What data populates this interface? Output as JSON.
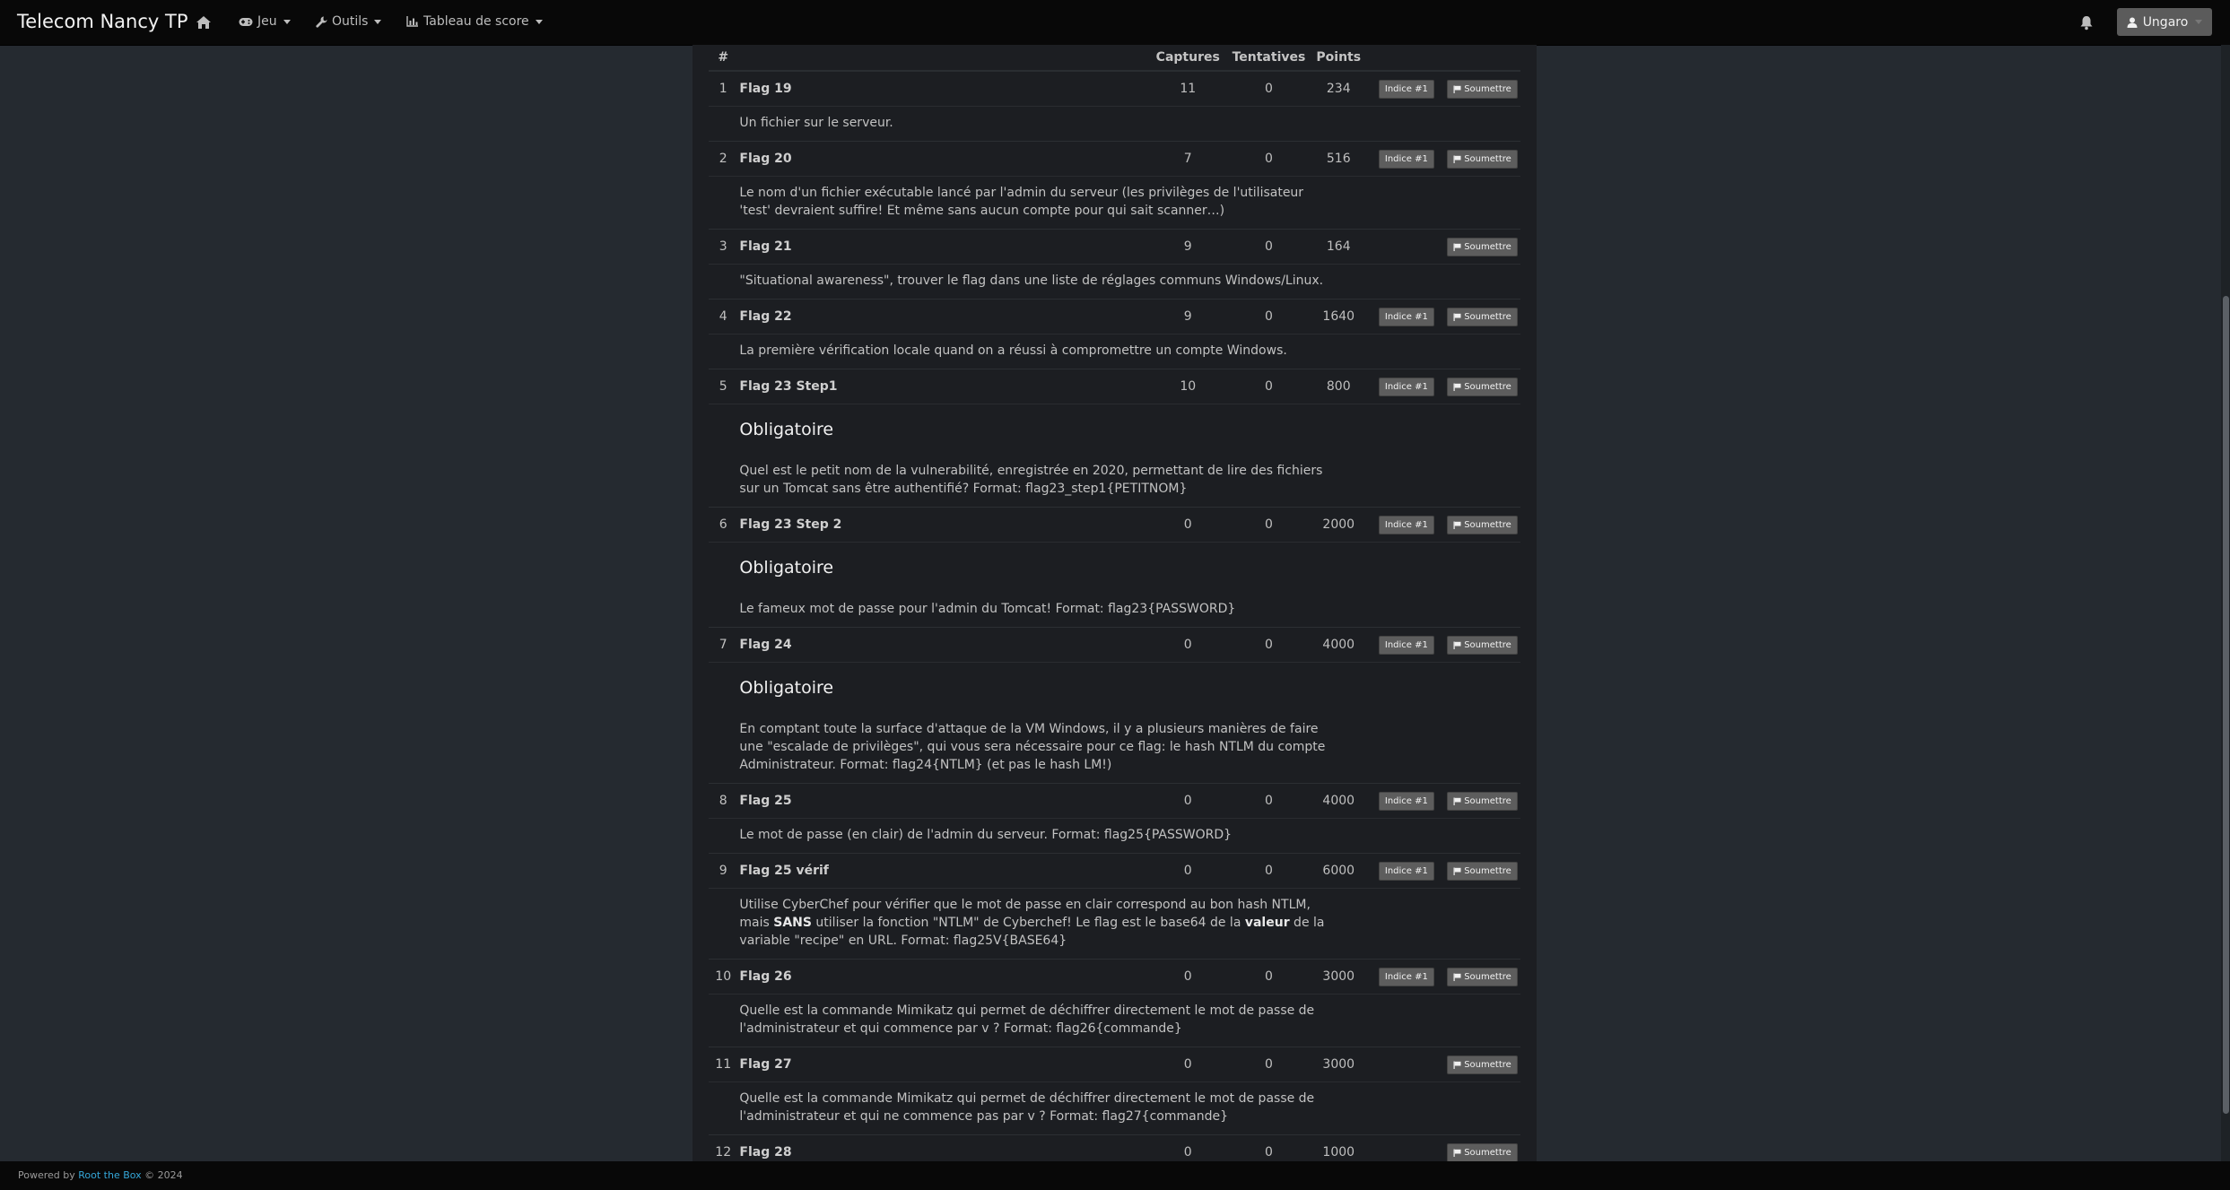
{
  "navbar": {
    "brand": "Telecom Nancy TP",
    "items": [
      {
        "label": "Jeu",
        "icon": "gamepad-icon"
      },
      {
        "label": "Outils",
        "icon": "wrench-icon"
      },
      {
        "label": "Tableau de score",
        "icon": "bar-chart-icon"
      }
    ],
    "user": "Ungaro"
  },
  "table": {
    "headers": {
      "num": "#",
      "name": "",
      "captures": "Captures",
      "attempts": "Tentatives",
      "points": "Points"
    },
    "hint_label": "Indice #1",
    "submit_label": "Soumettre",
    "mandatory_label": "Obligatoire",
    "rows": [
      {
        "num": "1",
        "name": "Flag 19",
        "captures": "11",
        "attempts": "0",
        "points": "234",
        "hint": true,
        "mandatory": false,
        "desc": "Un fichier sur le serveur."
      },
      {
        "num": "2",
        "name": "Flag 20",
        "captures": "7",
        "attempts": "0",
        "points": "516",
        "hint": true,
        "mandatory": false,
        "desc": "Le nom d'un fichier exécutable lancé par l'admin du serveur (les privilèges de l'utilisateur 'test' devraient suffire! Et même sans aucun compte pour qui sait scanner…)"
      },
      {
        "num": "3",
        "name": "Flag 21",
        "captures": "9",
        "attempts": "0",
        "points": "164",
        "hint": false,
        "mandatory": false,
        "desc": "\"Situational awareness\", trouver le flag dans une liste de réglages communs Windows/Linux."
      },
      {
        "num": "4",
        "name": "Flag 22",
        "captures": "9",
        "attempts": "0",
        "points": "1640",
        "hint": true,
        "mandatory": false,
        "desc": "La première vérification locale quand on a réussi à compromettre un compte Windows."
      },
      {
        "num": "5",
        "name": "Flag 23 Step1",
        "captures": "10",
        "attempts": "0",
        "points": "800",
        "hint": true,
        "mandatory": true,
        "desc": "Quel est le petit nom de la vulnerabilité, enregistrée en 2020, permettant de lire des fichiers sur un Tomcat sans être authentifié? Format: flag23_step1{PETITNOM}"
      },
      {
        "num": "6",
        "name": "Flag 23 Step 2",
        "captures": "0",
        "attempts": "0",
        "points": "2000",
        "hint": true,
        "mandatory": true,
        "desc": "Le fameux mot de passe pour l'admin du Tomcat! Format: flag23{PASSWORD}"
      },
      {
        "num": "7",
        "name": "Flag 24",
        "captures": "0",
        "attempts": "0",
        "points": "4000",
        "hint": true,
        "mandatory": true,
        "desc": "En comptant toute la surface d'attaque de la VM Windows, il y a plusieurs manières de faire une \"escalade de privilèges\", qui vous sera nécessaire pour ce flag: le hash NTLM du compte Administrateur. Format: flag24{NTLM} (et pas le hash LM!)"
      },
      {
        "num": "8",
        "name": "Flag 25",
        "captures": "0",
        "attempts": "0",
        "points": "4000",
        "hint": true,
        "mandatory": false,
        "desc": "Le mot de passe (en clair) de l'admin du serveur. Format: flag25{PASSWORD}"
      },
      {
        "num": "9",
        "name": "Flag 25 vérif",
        "captures": "0",
        "attempts": "0",
        "points": "6000",
        "hint": true,
        "mandatory": false,
        "desc_parts": [
          "Utilise CyberChef pour vérifier que le mot de passe en clair correspond au bon hash NTLM, mais ",
          "SANS",
          " utiliser la fonction \"NTLM\" de Cyberchef! Le flag est le base64 de la ",
          "valeur",
          " de la variable \"recipe\" en URL. Format: flag25V{BASE64}"
        ]
      },
      {
        "num": "10",
        "name": "Flag 26",
        "captures": "0",
        "attempts": "0",
        "points": "3000",
        "hint": true,
        "mandatory": false,
        "desc": "Quelle est la commande Mimikatz qui permet de déchiffrer directement le mot de passe de l'administrateur et qui commence par v ? Format: flag26{commande}"
      },
      {
        "num": "11",
        "name": "Flag 27",
        "captures": "0",
        "attempts": "0",
        "points": "3000",
        "hint": false,
        "mandatory": false,
        "desc": "Quelle est la commande Mimikatz qui permet de déchiffrer directement le mot de passe de l'administrateur et qui ne commence pas par v ? Format: flag27{commande}"
      },
      {
        "num": "12",
        "name": "Flag 28",
        "captures": "0",
        "attempts": "0",
        "points": "1000",
        "hint": false,
        "mandatory": false,
        "desc": ""
      }
    ]
  },
  "footer": {
    "prefix": "Powered by ",
    "link": "Root the Box",
    "suffix": " © 2024"
  }
}
